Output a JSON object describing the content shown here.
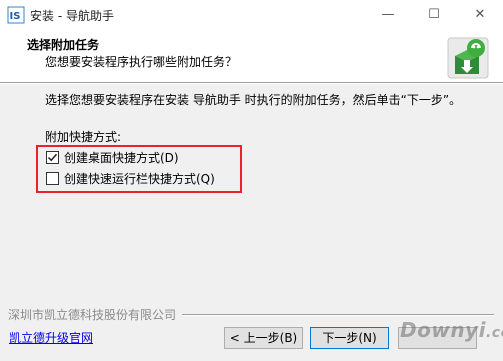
{
  "window": {
    "title": "安装 - 导航助手",
    "controls": {
      "minimize": "—",
      "maximize": "☐",
      "close": "✕"
    }
  },
  "header": {
    "title": "选择附加任务",
    "subtitle": "您想要安装程序执行哪些附加任务？"
  },
  "main": {
    "intro": "选择您想要安装程序在安装 导航助手 时执行的附加任务，然后单击“下一步”。",
    "group_label": "附加快捷方式:",
    "tasks": [
      {
        "label": "创建桌面快捷方式(D)",
        "checked": true
      },
      {
        "label": "创建快速运行栏快捷方式(Q)",
        "checked": false
      }
    ]
  },
  "footer": {
    "company": "深圳市凯立德科技股份有限公司",
    "link": "凯立德升级官网",
    "back_label": "< 上一步(B)",
    "next_label": "下一步(N)"
  },
  "watermark": {
    "brand": "Downyi",
    "domain": "com"
  },
  "colors": {
    "highlight": "#e8242a",
    "link": "#0000ee",
    "panel": "#f0f0f0"
  }
}
